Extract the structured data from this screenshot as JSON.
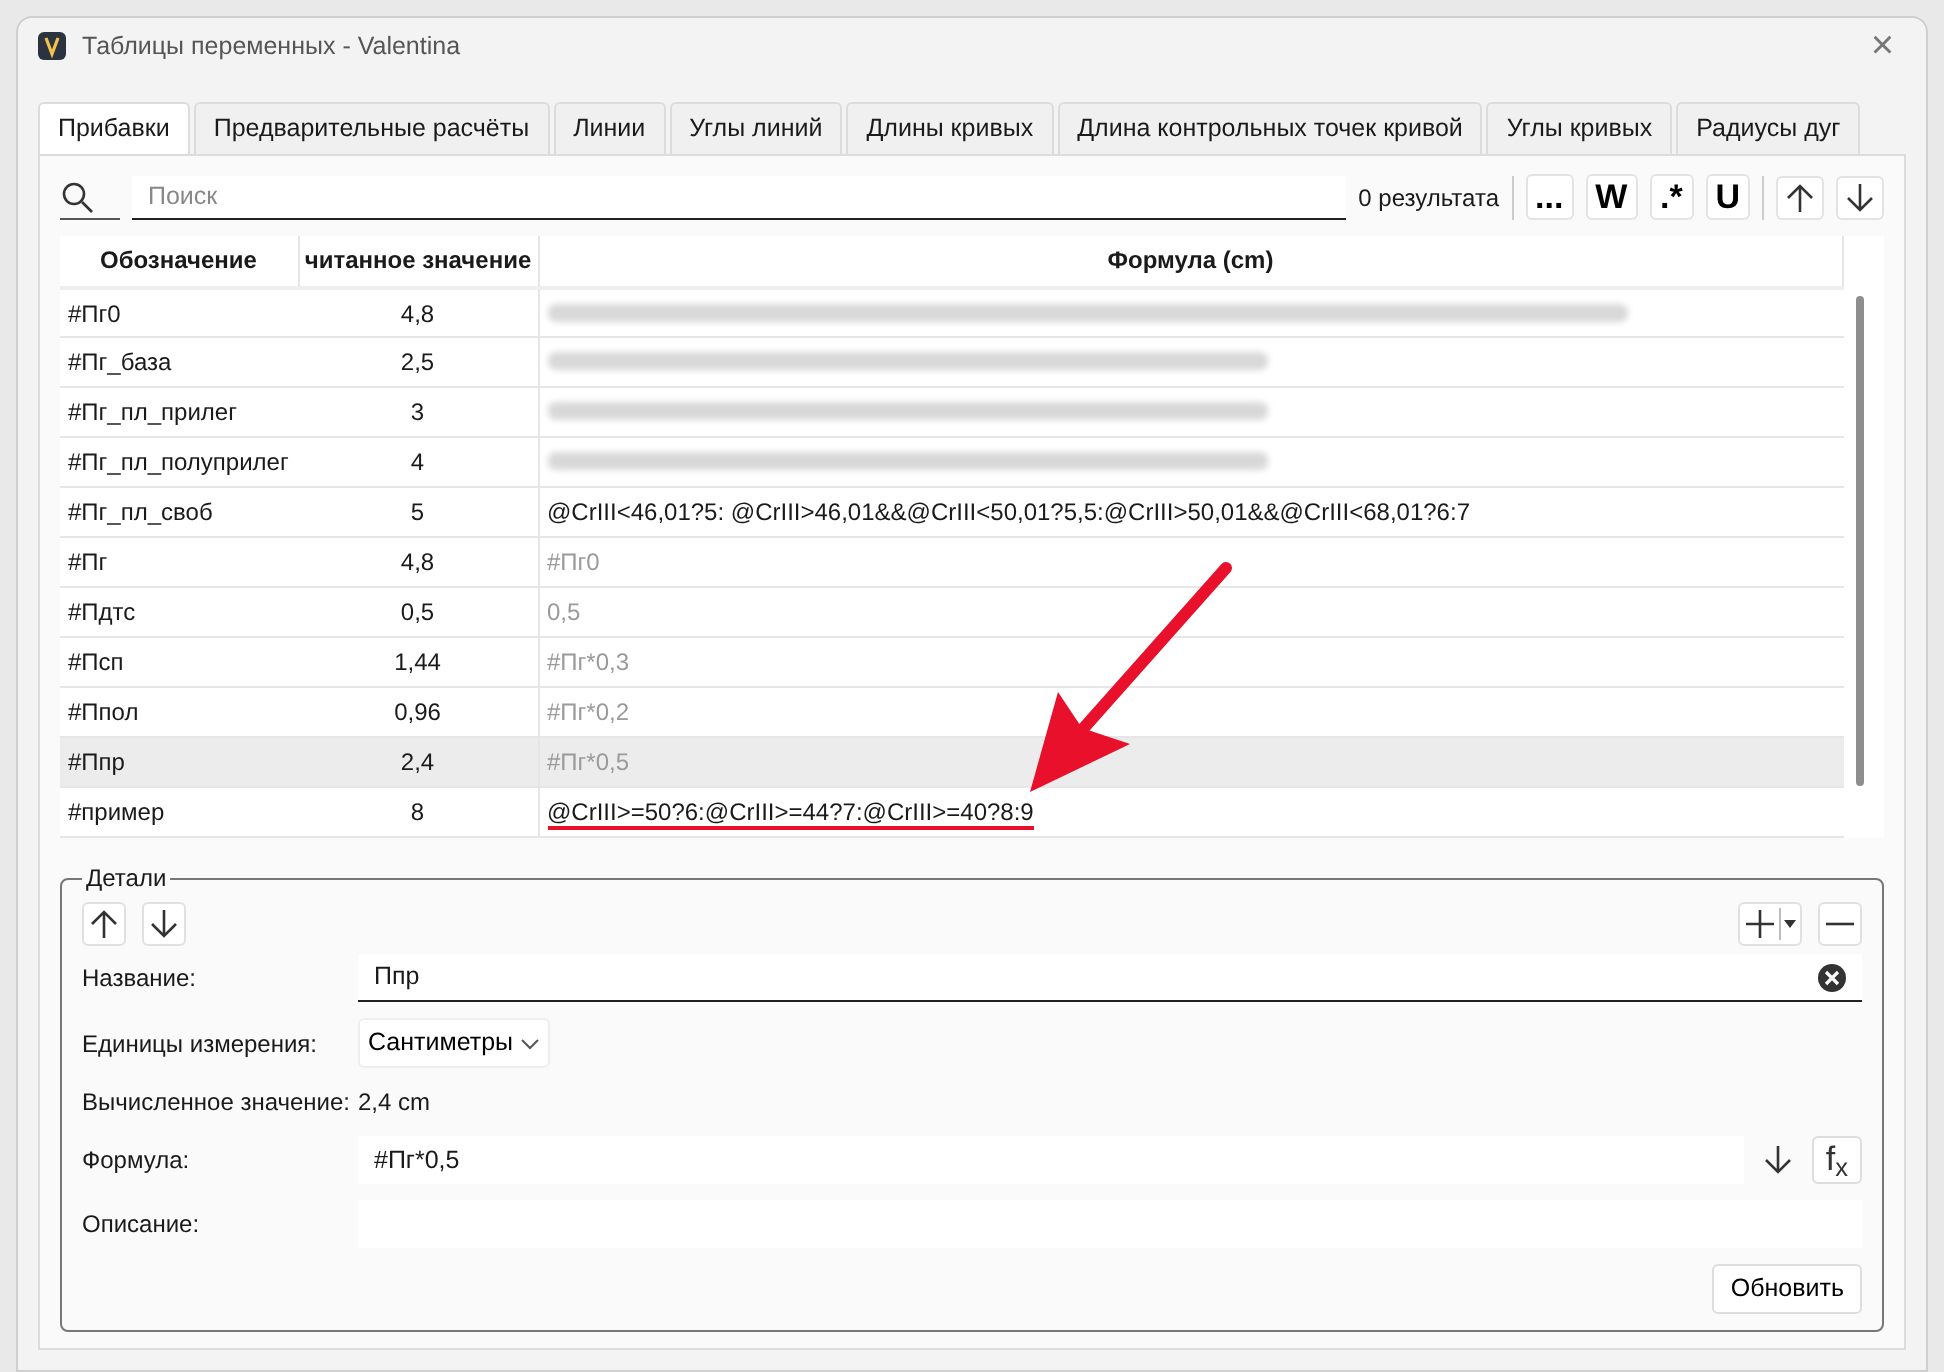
{
  "window": {
    "title": "Таблицы переменных - Valentina",
    "close": "×"
  },
  "tabs": [
    {
      "label": "Прибавки",
      "selected": true
    },
    {
      "label": "Предварительные расчёты",
      "selected": false
    },
    {
      "label": "Линии",
      "selected": false
    },
    {
      "label": "Углы линий",
      "selected": false
    },
    {
      "label": "Длины кривых",
      "selected": false
    },
    {
      "label": "Длина контрольных точек кривой",
      "selected": false
    },
    {
      "label": "Углы кривых",
      "selected": false
    },
    {
      "label": "Радиусы дуг",
      "selected": false
    }
  ],
  "search": {
    "placeholder": "Поиск",
    "results": "0 результата",
    "options": [
      "...",
      "W",
      ".*",
      "U"
    ]
  },
  "table": {
    "columns": [
      "Обозначение",
      "читанное значение",
      "Формула (cm)"
    ],
    "rows": [
      {
        "name": "#Пг0",
        "value": "4,8",
        "kind": "blurred",
        "selected": false
      },
      {
        "name": "#Пг_база",
        "value": "2,5",
        "kind": "blurred",
        "selected": false
      },
      {
        "name": "#Пг_пл_прилег",
        "value": "3",
        "kind": "blurred",
        "selected": false
      },
      {
        "name": "#Пг_пл_полуприлег",
        "value": "4",
        "kind": "blurred",
        "selected": false
      },
      {
        "name": "#Пг_пл_своб",
        "value": "5",
        "kind": "plain",
        "formula": "@CrIII<46,01?5: @CrIII>46,01&&@CrIII<50,01?5,5:@CrIII>50,01&&@CrIII<68,01?6:7",
        "selected": false
      },
      {
        "name": "#Пг",
        "value": "4,8",
        "kind": "faint",
        "formula": "#Пг0",
        "selected": false
      },
      {
        "name": "#Пдтс",
        "value": "0,5",
        "kind": "faint",
        "formula": "0,5",
        "selected": false
      },
      {
        "name": "#Псп",
        "value": "1,44",
        "kind": "faint",
        "formula": "#Пг*0,3",
        "selected": false
      },
      {
        "name": "#Ппол",
        "value": "0,96",
        "kind": "faint",
        "formula": "#Пг*0,2",
        "selected": false
      },
      {
        "name": "#Ппр",
        "value": "2,4",
        "kind": "faint",
        "formula": "#Пг*0,5",
        "selected": true
      },
      {
        "name": "#пример",
        "value": "8",
        "kind": "underlined",
        "formula": "@CrIII>=50?6:@CrIII>=44?7:@CrIII>=40?8:9",
        "selected": false
      }
    ]
  },
  "details": {
    "title": "Детали",
    "name_label": "Название:",
    "name_value": "Ппр",
    "units_label": "Единицы измерения:",
    "units_value": "Сантиметры",
    "calc_label": "Вычисленное значение:",
    "calc_value": "2,4 cm",
    "formula_label": "Формула:",
    "formula_value": "#Пг*0,5",
    "fx": "f$_{x}$",
    "description_label": "Описание:",
    "update_button": "Обновить"
  }
}
